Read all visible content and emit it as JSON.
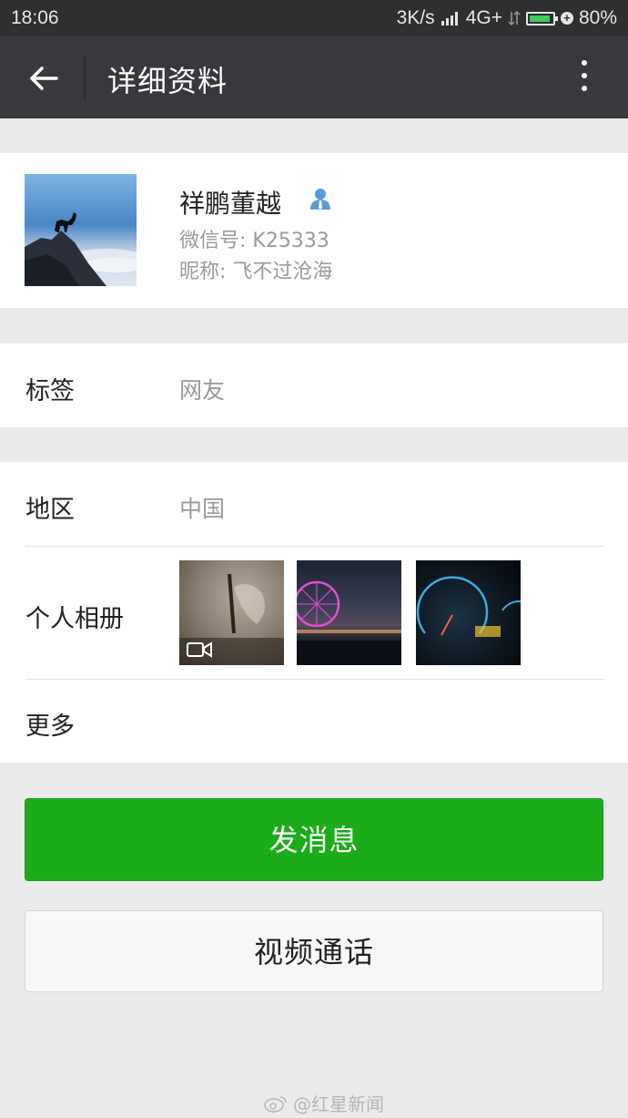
{
  "status_bar": {
    "time": "18:06",
    "network_speed": "3K/s",
    "network_type": "4G+",
    "battery": "80%",
    "battery_level": 0.8
  },
  "header": {
    "title": "详细资料",
    "back_icon": "arrow-left-icon",
    "more_icon": "more-vertical-icon"
  },
  "profile": {
    "name": "祥鹏董越",
    "wechat_id": "微信号: K25333",
    "nickname": "昵称: 飞不过沧海",
    "badge_icon": "contact-person-icon"
  },
  "rows": {
    "tag_label": "标签",
    "tag_value": "网友",
    "region_label": "地区",
    "region_value": "中国",
    "album_label": "个人相册",
    "more_label": "更多"
  },
  "buttons": {
    "send_message": "发消息",
    "video_call": "视频通话"
  },
  "watermark": {
    "text": "@红星新闻"
  },
  "colors": {
    "primary_green": "#1aad19",
    "nav_bg": "#38393c",
    "status_bg": "#2e2f31"
  }
}
